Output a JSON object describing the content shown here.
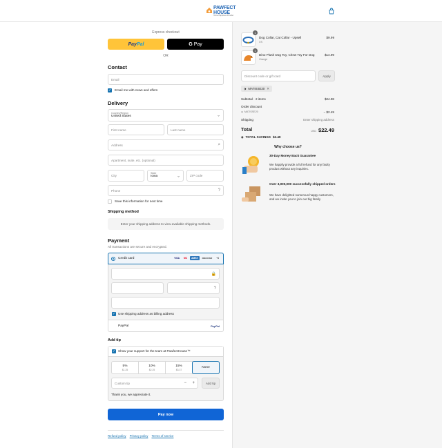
{
  "brand": {
    "name": "PAWFECT HOUSE",
    "tagline": "Home Happiness Provider"
  },
  "express": {
    "label": "Express checkout",
    "paypal": [
      "Pay",
      "Pal"
    ],
    "gpay_letter": "G",
    "gpay_label": "Pay",
    "or": "OR"
  },
  "contact": {
    "title": "Contact",
    "email_placeholder": "Email",
    "news_label": "Email me with news and offers"
  },
  "delivery": {
    "title": "Delivery",
    "country_label": "Country/Region",
    "country_value": "United States",
    "first_name": "First name",
    "last_name": "Last name",
    "address": "Address",
    "apartment": "Apartment, suite, etc. (optional)",
    "city": "City",
    "state_label": "State",
    "state_value": "Iowa",
    "zip": "ZIP code",
    "phone": "Phone",
    "save_info": "Save this information for next time"
  },
  "shipping_method": {
    "title": "Shipping method",
    "message": "Enter your shipping address to view available shipping methods."
  },
  "payment": {
    "title": "Payment",
    "subtitle": "All transactions are secure and encrypted.",
    "credit_card": "Credit card",
    "card_logos": [
      "VISA",
      "MC",
      "AMEX",
      "DISCOVER",
      "+4"
    ],
    "billing_same": "Use shipping address as billing address",
    "paypal": "PayPal",
    "paypal_logo": "PayPal"
  },
  "tip": {
    "title": "Add tip",
    "show_support": "Show your support for the team at PawfectHouse™",
    "options": [
      {
        "pct": "5%",
        "amt": "$1.25"
      },
      {
        "pct": "10%",
        "amt": "$2.25"
      },
      {
        "pct": "15%",
        "amt": "$3.37"
      },
      {
        "pct": "None",
        "amt": ""
      }
    ],
    "custom_placeholder": "Custom tip",
    "minus": "−",
    "plus": "+",
    "add_button": "Add tip",
    "thanks": "Thank you, we appreciate it."
  },
  "pay_now": "Pay now",
  "footer": {
    "refund": "Refund policy",
    "privacy": "Privacy policy",
    "terms": "Terms of service"
  },
  "cart": {
    "items": [
      {
        "name": "Dog Collar, Cat Collar - Upsell",
        "variant": "XS",
        "price": "$9.99",
        "qty": "1"
      },
      {
        "name": "Dino Plush Dog Toy, Chew Toy For Dog",
        "variant": "Orange",
        "price": "$14.99",
        "qty": "1"
      }
    ],
    "discount_placeholder": "Discount code or gift card",
    "apply": "Apply",
    "code_tag": "MATISSE20",
    "subtotal_label": "Subtotal · 2 items",
    "subtotal_value": "$24.98",
    "order_discount_label": "Order discount",
    "discount_code": "MATISSE20",
    "discount_value": "− $2.49",
    "shipping_label": "Shipping",
    "shipping_value": "Enter shipping address",
    "total_label": "Total",
    "currency": "USD",
    "total_value": "$22.49",
    "savings_label": "TOTAL SAVINGS",
    "savings_value": "$2.49"
  },
  "why": {
    "title": "Why choose us?",
    "points": [
      {
        "title": "30-Day Money Back Guarantee",
        "text": "We happily provide a full refund for any faulty product without any inquiries."
      },
      {
        "title": "Over 3,000,000 successfully shipped orders",
        "text": "We have delighted numerous happy customers, and we invite you to join our big family"
      }
    ]
  }
}
